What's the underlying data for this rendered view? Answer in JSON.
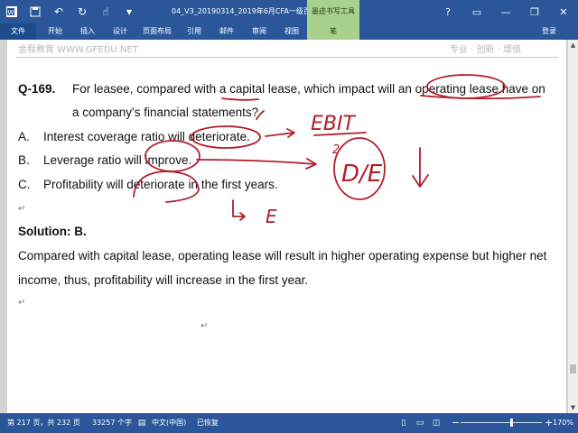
{
  "window": {
    "title": "04_V3_20190314_2019年6月CFA一级百题预...",
    "context_tab_group": "墨迹书写工具",
    "controls": {
      "help": "?",
      "ribbon_options": "▭",
      "minimize": "—",
      "restore": "❐",
      "close": "✕"
    }
  },
  "quick_access": {
    "save_icon": "save-icon",
    "undo_icon": "undo-icon",
    "redo_icon": "redo-icon",
    "touch_icon": "touch-mode-icon"
  },
  "ribbon": {
    "tabs": [
      "文件",
      "开始",
      "插入",
      "设计",
      "页面布局",
      "引用",
      "邮件",
      "审阅",
      "视图",
      "笔"
    ],
    "login": "登录"
  },
  "document": {
    "header_left": "金程教育 WWW.GFEDU.NET",
    "header_right": "专业 · 创新 · 增值",
    "question": {
      "id": "Q-169.",
      "line1_a": "For leasee, compared with a capital lease, which impact will an operating lease have on",
      "line1_b": "a company’s financial statements?",
      "options": [
        {
          "letter": "A.",
          "text": "Interest coverage ratio will deteriorate."
        },
        {
          "letter": "B.",
          "text": "Leverage ratio will improve."
        },
        {
          "letter": "C.",
          "text": "Profitability will deteriorate in the first years."
        }
      ]
    },
    "solution_label": "Solution: B.",
    "solution_line1": "Compared with capital lease, operating lease will result in higher operating expense but higher net",
    "solution_line2": "income, thus, profitability will increase in the first year.",
    "handwriting": {
      "ebit": "EBIT",
      "two": "2",
      "de": "D/E",
      "e": "E"
    }
  },
  "status": {
    "page": "第 217 页，共 232 页",
    "words": "33257 个字",
    "language": "中文(中国)",
    "recovered": "已恢复",
    "zoom": "170%",
    "zoom_fraction": 0.62
  }
}
